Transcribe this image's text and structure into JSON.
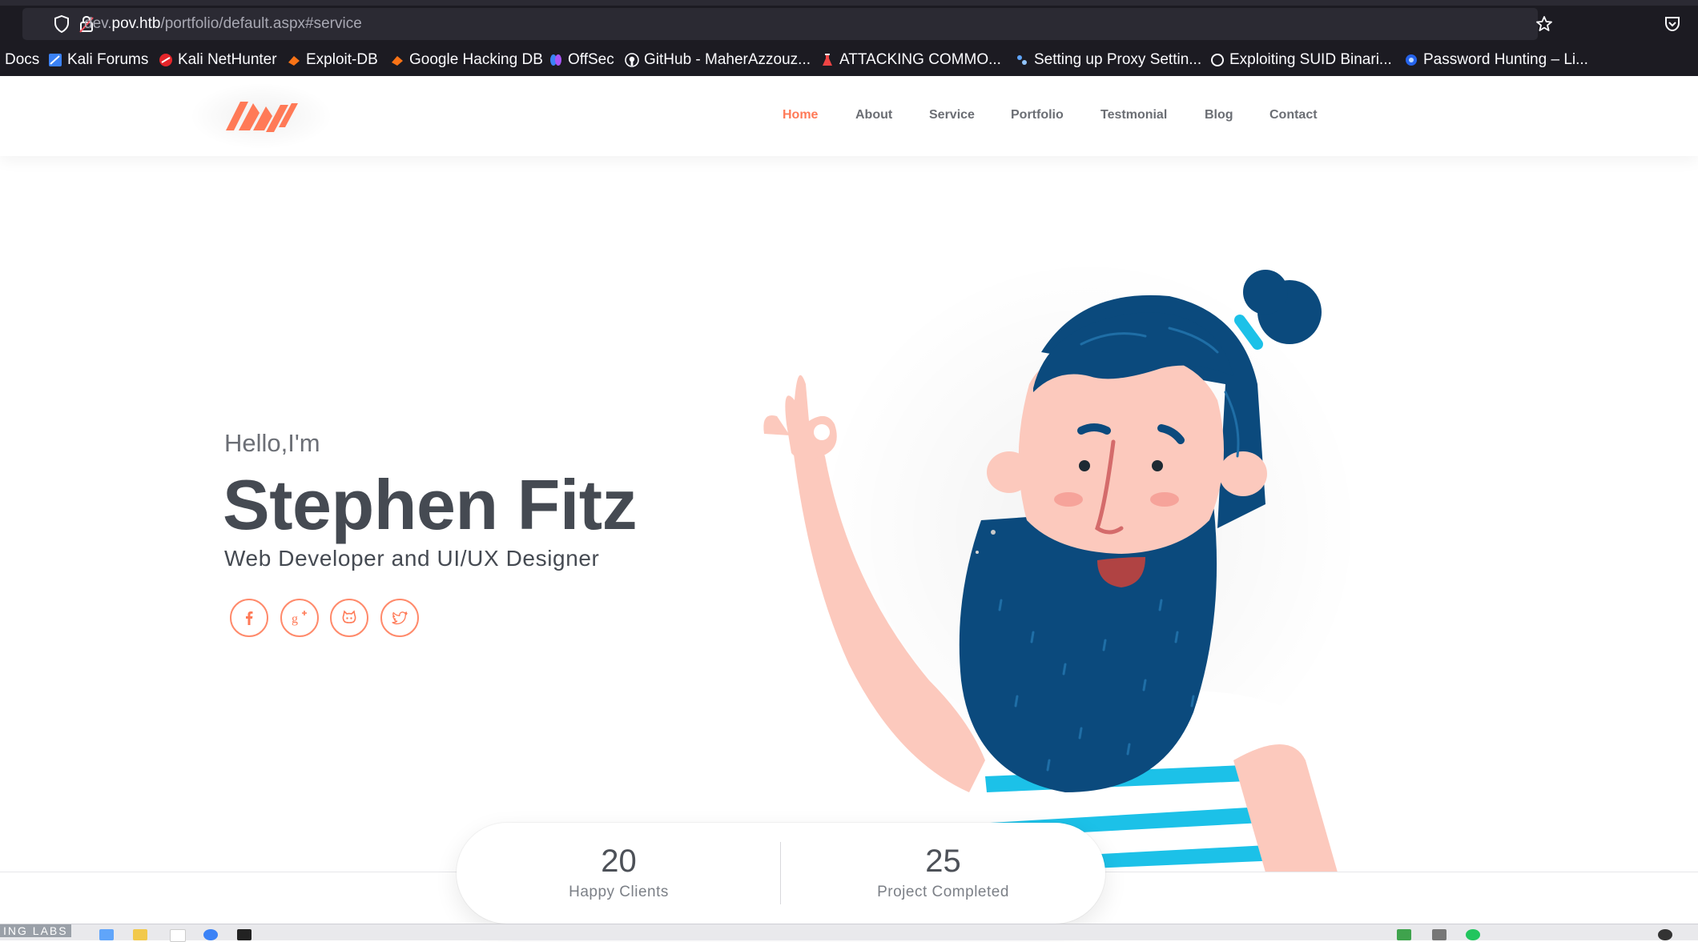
{
  "browser": {
    "url_prefix": "dev.",
    "url_domain": "pov.htb",
    "url_path": "/portfolio/default.aspx#service",
    "bookmarks": [
      {
        "label": "Docs",
        "icon": "doc-icon"
      },
      {
        "label": "Kali Forums",
        "icon": "kali-icon"
      },
      {
        "label": "Kali NetHunter",
        "icon": "nethunter-icon"
      },
      {
        "label": "Exploit-DB",
        "icon": "exploitdb-icon"
      },
      {
        "label": "Google Hacking DB",
        "icon": "ghdb-icon"
      },
      {
        "label": "OffSec",
        "icon": "offsec-icon"
      },
      {
        "label": "GitHub - MaherAzzouz...",
        "icon": "github-icon"
      },
      {
        "label": "ATTACKING COMMO...",
        "icon": "flask-icon"
      },
      {
        "label": "Setting up Proxy Settin...",
        "icon": "proxy-icon"
      },
      {
        "label": "Exploiting SUID Binari...",
        "icon": "circle-icon"
      },
      {
        "label": "Password Hunting – Li...",
        "icon": "globe-icon"
      }
    ]
  },
  "nav": {
    "items": [
      {
        "label": "Home",
        "active": true
      },
      {
        "label": "About",
        "active": false
      },
      {
        "label": "Service",
        "active": false
      },
      {
        "label": "Portfolio",
        "active": false
      },
      {
        "label": "Testmonial",
        "active": false
      },
      {
        "label": "Blog",
        "active": false
      },
      {
        "label": "Contact",
        "active": false
      }
    ]
  },
  "hero": {
    "greeting": "Hello,I'm",
    "name": "Stephen Fitz",
    "role": "Web Developer and UI/UX Designer",
    "social": [
      {
        "icon": "facebook-icon"
      },
      {
        "icon": "google-plus-icon"
      },
      {
        "icon": "github-icon"
      },
      {
        "icon": "twitter-icon"
      }
    ]
  },
  "stats": [
    {
      "value": "20",
      "label": "Happy Clients"
    },
    {
      "value": "25",
      "label": "Project Completed"
    }
  ],
  "taskbar": {
    "corner_text": "ING LABS"
  },
  "colors": {
    "accent": "#ff7a57",
    "text_dark": "#454a52",
    "beard": "#0b4a7d",
    "skin": "#fcc9bd",
    "stripe": "#1cc1e8"
  }
}
